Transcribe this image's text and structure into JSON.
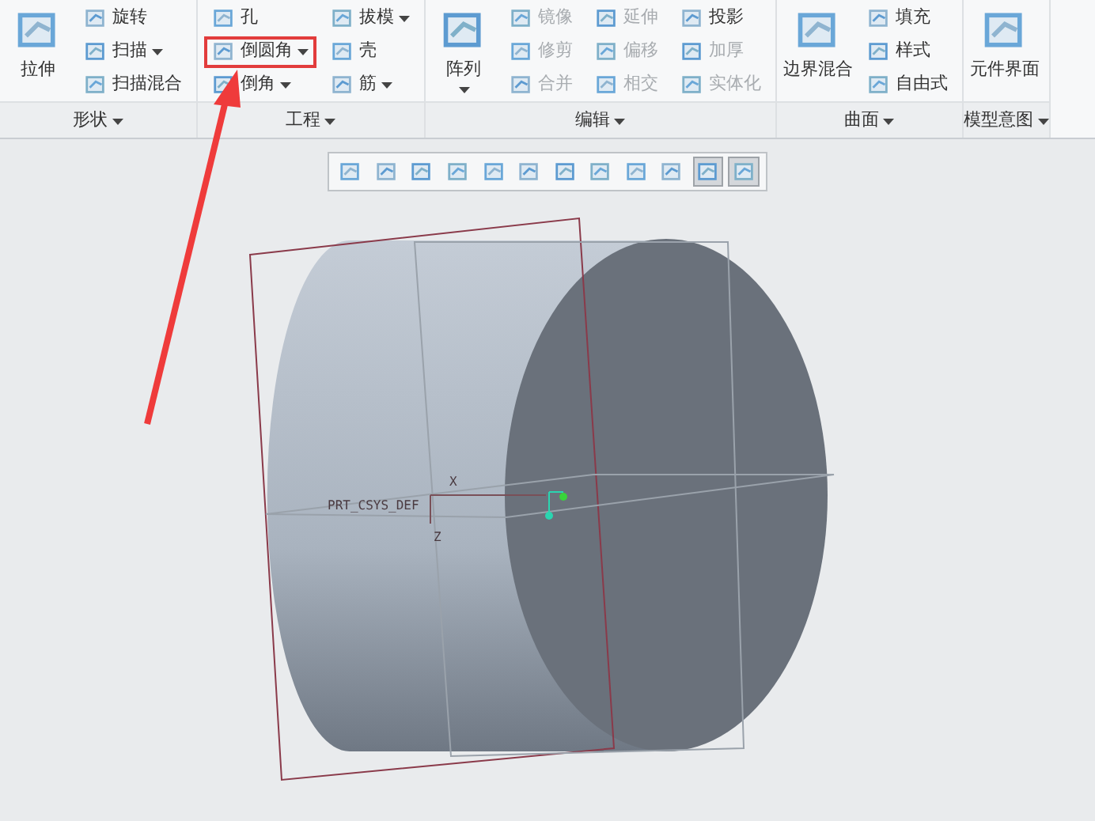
{
  "ribbon": {
    "groups": [
      {
        "label": "形状",
        "columns": [
          {
            "kind": "large",
            "items": [
              {
                "label": "拉伸",
                "caret": false
              }
            ]
          },
          {
            "kind": "small",
            "items": [
              {
                "label": "旋转",
                "caret": false,
                "disabled": false,
                "highlighted": false
              },
              {
                "label": "扫描",
                "caret": true,
                "disabled": false,
                "highlighted": false
              },
              {
                "label": "扫描混合",
                "caret": false,
                "disabled": false,
                "highlighted": false
              }
            ]
          }
        ]
      },
      {
        "label": "工程",
        "columns": [
          {
            "kind": "small",
            "items": [
              {
                "label": "孔",
                "caret": false,
                "disabled": false,
                "highlighted": false
              },
              {
                "label": "倒圆角",
                "caret": true,
                "disabled": false,
                "highlighted": true
              },
              {
                "label": "倒角",
                "caret": true,
                "disabled": false,
                "highlighted": false
              }
            ]
          },
          {
            "kind": "small",
            "items": [
              {
                "label": "拔模",
                "caret": true,
                "disabled": false,
                "highlighted": false
              },
              {
                "label": "壳",
                "caret": false,
                "disabled": false,
                "highlighted": false
              },
              {
                "label": "筋",
                "caret": true,
                "disabled": false,
                "highlighted": false
              }
            ]
          }
        ]
      },
      {
        "label": "编辑",
        "columns": [
          {
            "kind": "large",
            "items": [
              {
                "label": "阵列",
                "caret": true
              }
            ]
          },
          {
            "kind": "small",
            "items": [
              {
                "label": "镜像",
                "caret": false,
                "disabled": true,
                "highlighted": false
              },
              {
                "label": "修剪",
                "caret": false,
                "disabled": true,
                "highlighted": false
              },
              {
                "label": "合并",
                "caret": false,
                "disabled": true,
                "highlighted": false
              }
            ]
          },
          {
            "kind": "small",
            "items": [
              {
                "label": "延伸",
                "caret": false,
                "disabled": true,
                "highlighted": false
              },
              {
                "label": "偏移",
                "caret": false,
                "disabled": true,
                "highlighted": false
              },
              {
                "label": "相交",
                "caret": false,
                "disabled": true,
                "highlighted": false
              }
            ]
          },
          {
            "kind": "small",
            "items": [
              {
                "label": "投影",
                "caret": false,
                "disabled": false,
                "highlighted": false
              },
              {
                "label": "加厚",
                "caret": false,
                "disabled": true,
                "highlighted": false
              },
              {
                "label": "实体化",
                "caret": false,
                "disabled": true,
                "highlighted": false
              }
            ]
          }
        ]
      },
      {
        "label": "曲面",
        "columns": [
          {
            "kind": "large",
            "items": [
              {
                "label": "边界混合",
                "caret": false
              }
            ]
          },
          {
            "kind": "small",
            "items": [
              {
                "label": "填充",
                "caret": false,
                "disabled": false,
                "highlighted": false
              },
              {
                "label": "样式",
                "caret": false,
                "disabled": false,
                "highlighted": false
              },
              {
                "label": "自由式",
                "caret": false,
                "disabled": false,
                "highlighted": false
              }
            ]
          }
        ]
      },
      {
        "label": "模型意图",
        "columns": [
          {
            "kind": "large",
            "items": [
              {
                "label": "元件界面",
                "caret": false
              }
            ]
          }
        ]
      }
    ]
  },
  "view_toolbar": [
    {
      "selected": false
    },
    {
      "selected": false
    },
    {
      "selected": false
    },
    {
      "selected": false
    },
    {
      "selected": false
    },
    {
      "selected": false
    },
    {
      "selected": false
    },
    {
      "selected": false
    },
    {
      "selected": false
    },
    {
      "selected": false
    },
    {
      "selected": true
    },
    {
      "selected": true
    }
  ],
  "viewport": {
    "csys_label": "PRT_CSYS_DEF",
    "axis_labels": [
      "X",
      "Z"
    ]
  }
}
